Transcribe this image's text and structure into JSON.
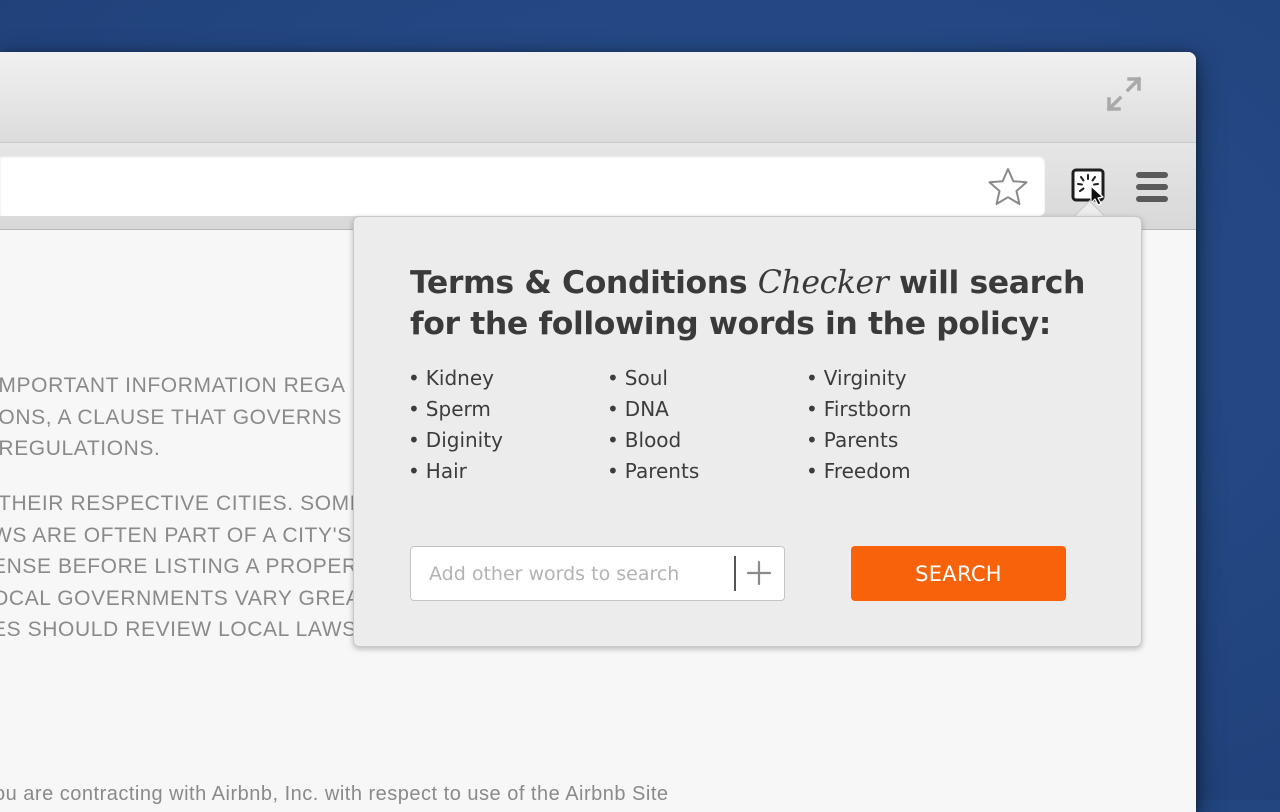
{
  "colors": {
    "desktop_background": "#234681",
    "search_button": "#f7620a",
    "popup_background": "#ececec",
    "page_text": "#8a8a8a"
  },
  "titlebar": {
    "fullscreen_icon": "expand-arrows-icon"
  },
  "toolbar": {
    "bookmark_icon": "star-icon",
    "extension_icon": "terms-checker-extension-icon",
    "menu_icon": "hamburger-menu-icon"
  },
  "page": {
    "paragraph1": [
      "IMPORTANT INFORMATION REGA",
      "IONS, A CLAUSE THAT GOVERNS",
      " REGULATIONS."
    ],
    "paragraph2": [
      " THEIR RESPECTIVE CITIES. SOME",
      "WS ARE OFTEN PART OF A CITY'S",
      "ENSE BEFORE LISTING A PROPERTY",
      "OCAL GOVERNMENTS VARY GREA",
      "ES SHOULD REVIEW LOCAL LAWS"
    ],
    "footer": "ou are contracting with Airbnb, Inc. with respect to use of the Airbnb Site"
  },
  "popup": {
    "title_part1": "Terms & Conditions ",
    "title_italic": "Checker",
    "title_part2": " will search for the following words in the policy:",
    "columns": [
      [
        "Kidney",
        "Sperm",
        "Diginity",
        "Hair"
      ],
      [
        "Soul",
        "DNA",
        "Blood",
        "Parents"
      ],
      [
        "Virginity",
        "Firstborn",
        "Parents",
        "Freedom"
      ]
    ],
    "add_placeholder": "Add other words to search",
    "add_icon": "plus-icon",
    "search_label": "SEARCH"
  }
}
